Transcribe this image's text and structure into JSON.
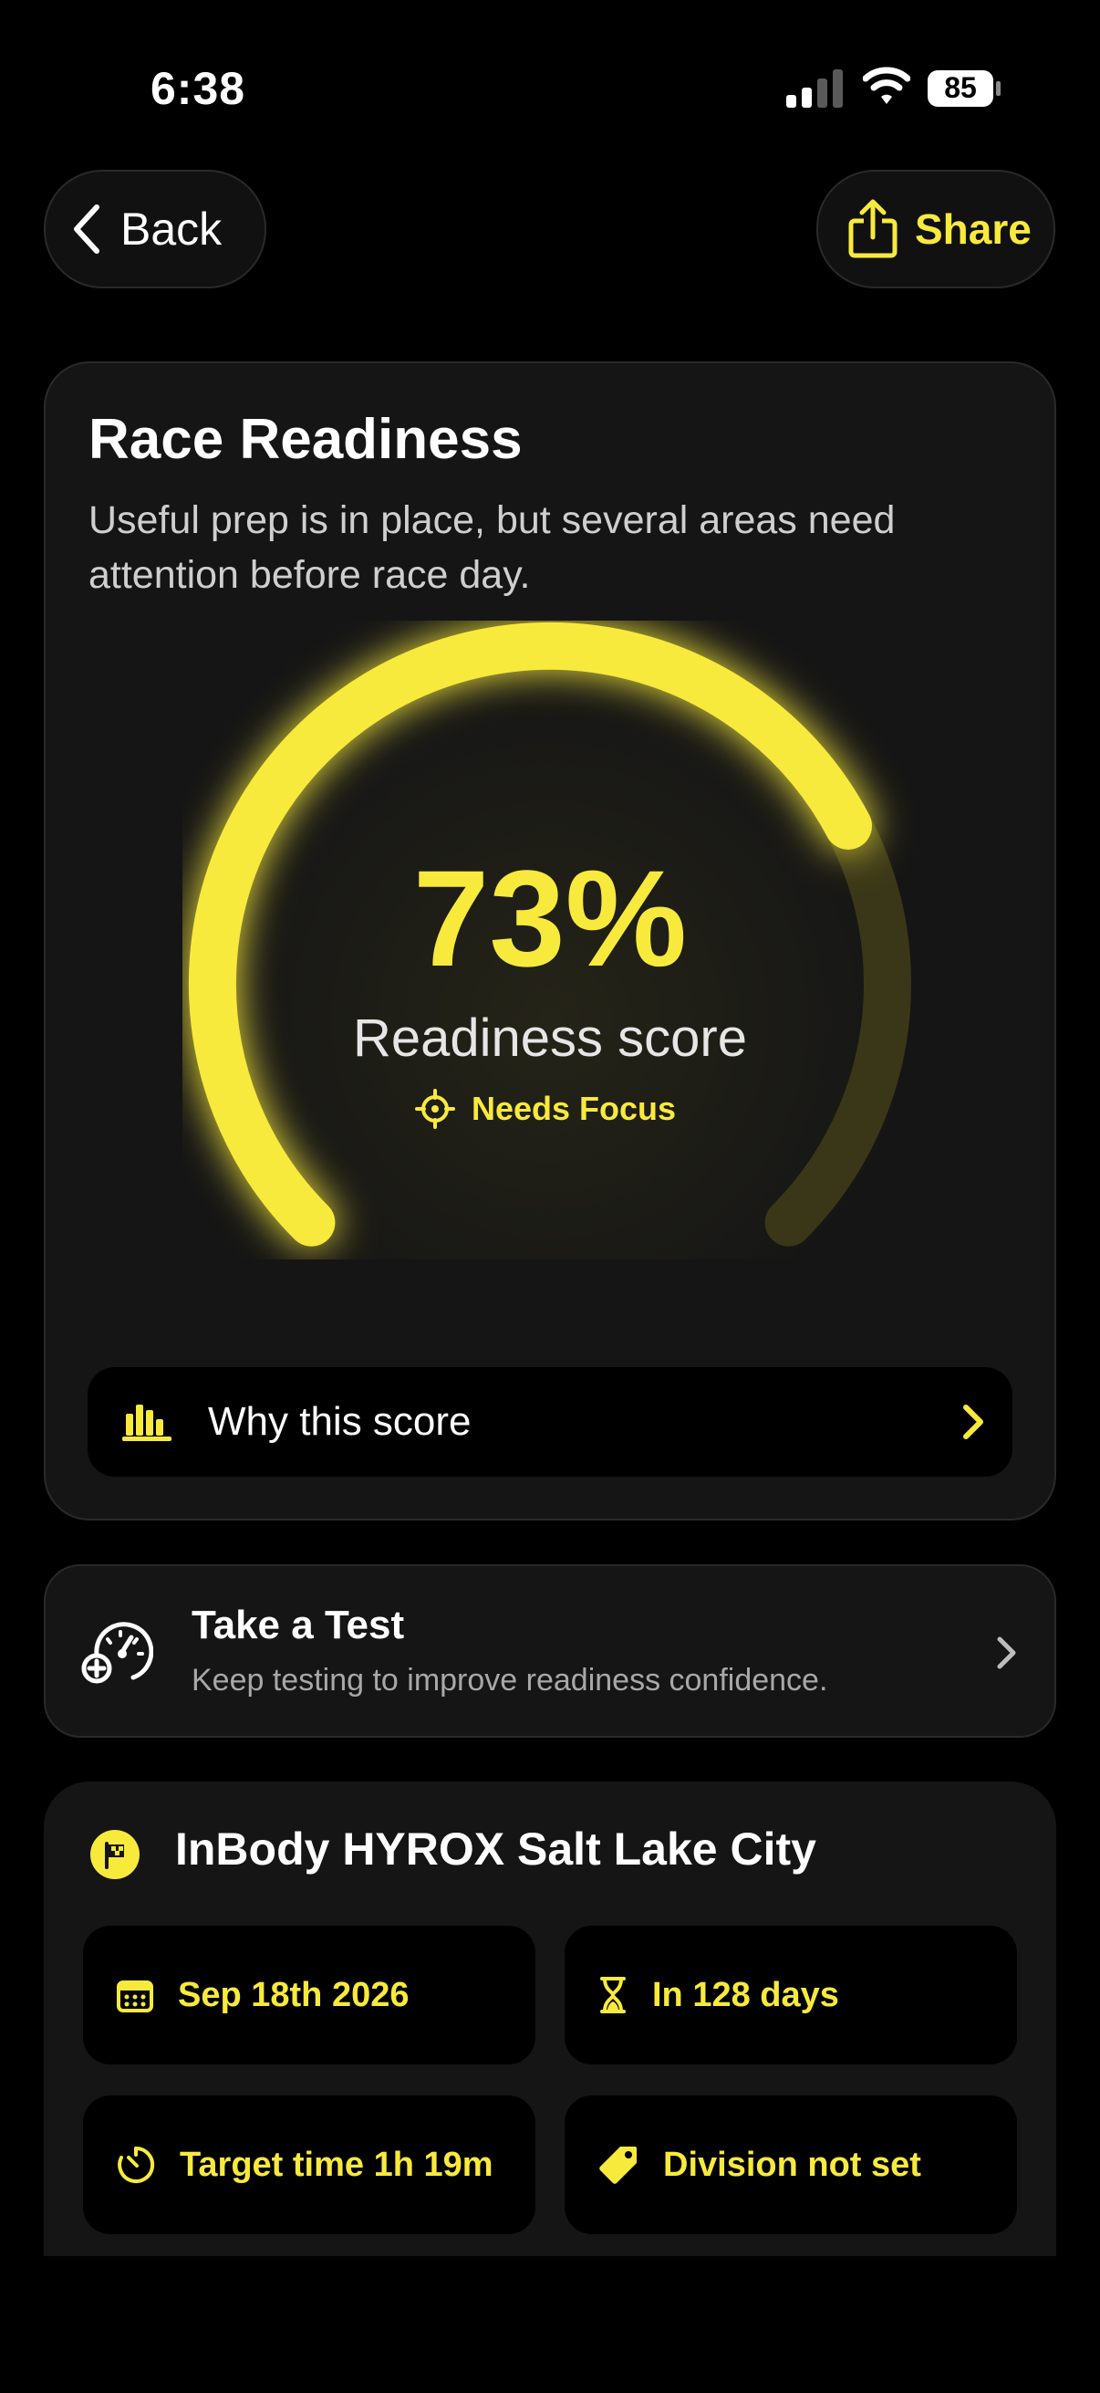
{
  "status_bar": {
    "time": "6:38",
    "battery": "85",
    "icons": [
      "signal-icon",
      "wifi-icon",
      "battery-icon"
    ]
  },
  "nav": {
    "back_label": "Back",
    "share_label": "Share"
  },
  "readiness": {
    "title": "Race Readiness",
    "subtitle": "Useful prep is in place, but several areas need attention before race day.",
    "score_text": "73%",
    "score_value": 0.73,
    "score_label": "Readiness score",
    "status": "Needs Focus",
    "why_label": "Why this score"
  },
  "test": {
    "title": "Take a Test",
    "subtitle": "Keep testing to improve readiness confidence."
  },
  "race": {
    "name": "InBody HYROX Salt Lake City",
    "date": "Sep 18th 2026",
    "countdown": "In 128 days",
    "target_time": "Target time 1h 19m",
    "division": "Division not set"
  },
  "colors": {
    "accent": "#f8ea3c",
    "background": "#000000",
    "card": "#151515",
    "gauge_track": "#3a3718"
  }
}
